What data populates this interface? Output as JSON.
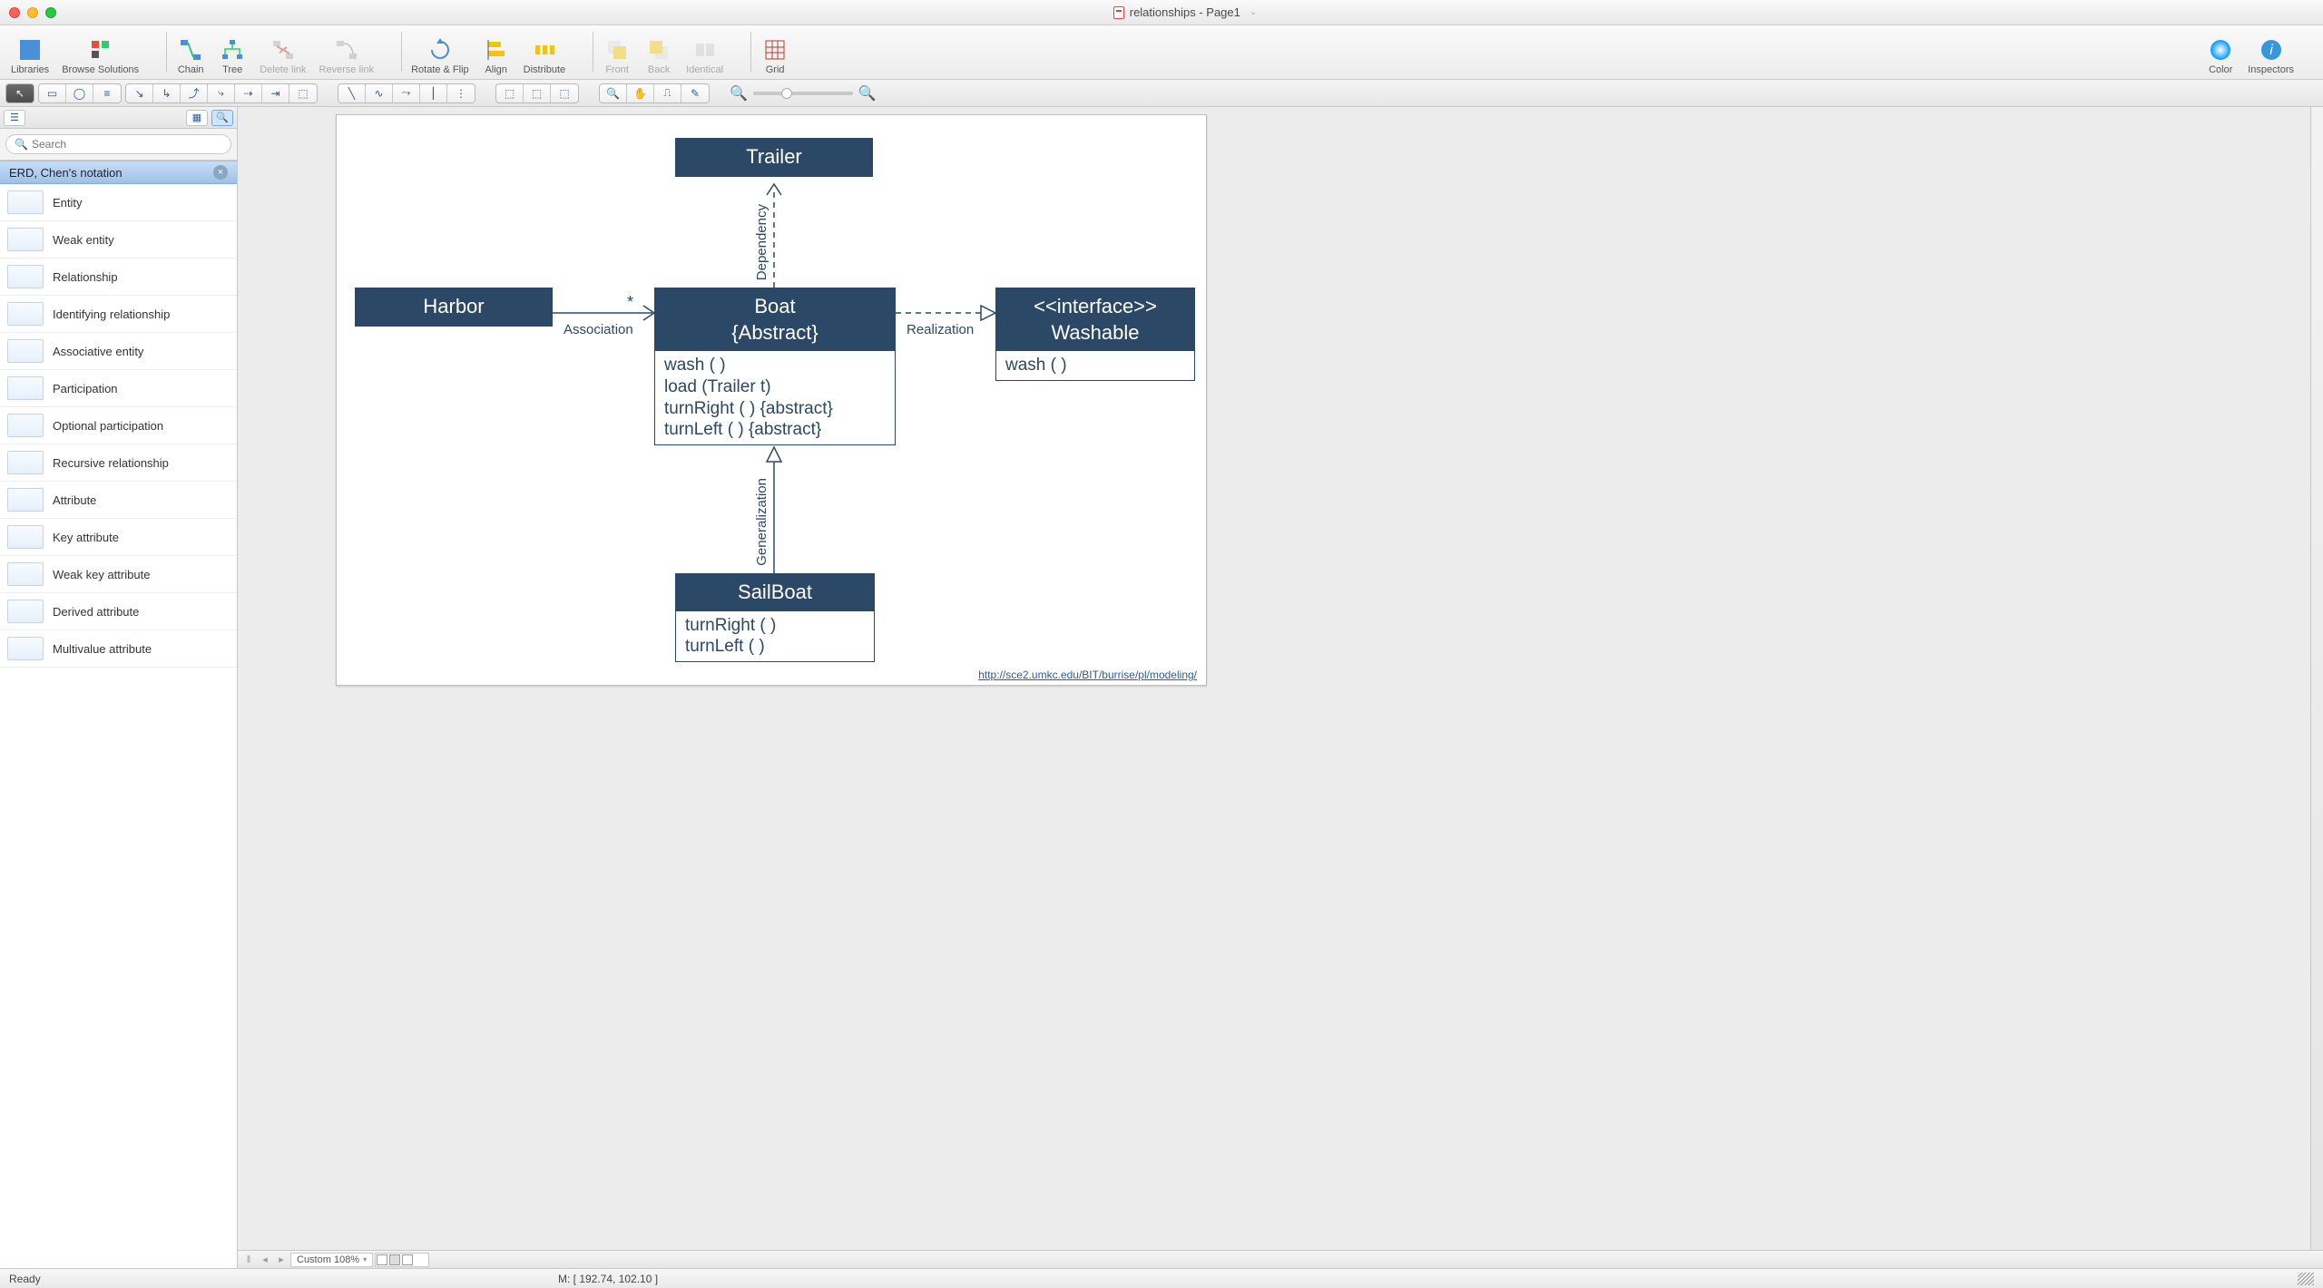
{
  "window": {
    "title": "relationships - Page1"
  },
  "toolbar": {
    "groups": [
      {
        "items": [
          {
            "key": "libraries",
            "label": "Libraries",
            "dim": false
          },
          {
            "key": "browse",
            "label": "Browse Solutions",
            "dim": false
          }
        ]
      },
      {
        "items": [
          {
            "key": "chain",
            "label": "Chain",
            "dim": false
          },
          {
            "key": "tree",
            "label": "Tree",
            "dim": false
          },
          {
            "key": "dlink",
            "label": "Delete link",
            "dim": true
          },
          {
            "key": "rlink",
            "label": "Reverse link",
            "dim": true
          }
        ]
      },
      {
        "items": [
          {
            "key": "roflip",
            "label": "Rotate & Flip",
            "dim": false
          },
          {
            "key": "align",
            "label": "Align",
            "dim": false
          },
          {
            "key": "distr",
            "label": "Distribute",
            "dim": false
          }
        ]
      },
      {
        "items": [
          {
            "key": "front",
            "label": "Front",
            "dim": true
          },
          {
            "key": "back",
            "label": "Back",
            "dim": true
          },
          {
            "key": "ident",
            "label": "Identical",
            "dim": true
          }
        ]
      },
      {
        "items": [
          {
            "key": "grid",
            "label": "Grid",
            "dim": false
          }
        ]
      },
      {
        "items": [
          {
            "key": "color",
            "label": "Color",
            "dim": false
          },
          {
            "key": "insp",
            "label": "Inspectors",
            "dim": false
          }
        ]
      }
    ]
  },
  "sidebar": {
    "search_placeholder": "Search",
    "section_title": "ERD, Chen's notation",
    "items": [
      {
        "label": "Entity"
      },
      {
        "label": "Weak entity"
      },
      {
        "label": "Relationship"
      },
      {
        "label": "Identifying relationship"
      },
      {
        "label": "Associative entity"
      },
      {
        "label": "Participation"
      },
      {
        "label": "Optional participation"
      },
      {
        "label": "Recursive relationship"
      },
      {
        "label": "Attribute"
      },
      {
        "label": "Key attribute"
      },
      {
        "label": "Weak key attribute"
      },
      {
        "label": "Derived attribute"
      },
      {
        "label": "Multivalue attribute"
      }
    ]
  },
  "diagram": {
    "trailer": {
      "title": "Trailer"
    },
    "harbor": {
      "title": "Harbor"
    },
    "boat": {
      "title": "Boat",
      "subtitle": "{Abstract}",
      "methods": [
        "wash ( )",
        "load (Trailer t)",
        "turnRight ( ) {abstract}",
        "turnLeft ( ) {abstract}"
      ]
    },
    "washable": {
      "stereo": "<<interface>>",
      "title": "Washable",
      "methods": [
        "wash ( )"
      ]
    },
    "sailboat": {
      "title": "SailBoat",
      "methods": [
        "turnRight ( )",
        "turnLeft ( )"
      ]
    },
    "labels": {
      "dependency": "Dependency",
      "association": "Association",
      "assoc_mult": "*",
      "realization": "Realization",
      "generalization": "Generalization"
    },
    "source_link": "http://sce2.umkc.edu/BIT/burrise/pl/modeling/"
  },
  "tabstrip": {
    "zoom_label": "Custom 108%"
  },
  "status": {
    "ready": "Ready",
    "mouse": "M: [ 192.74, 102.10 ]"
  }
}
